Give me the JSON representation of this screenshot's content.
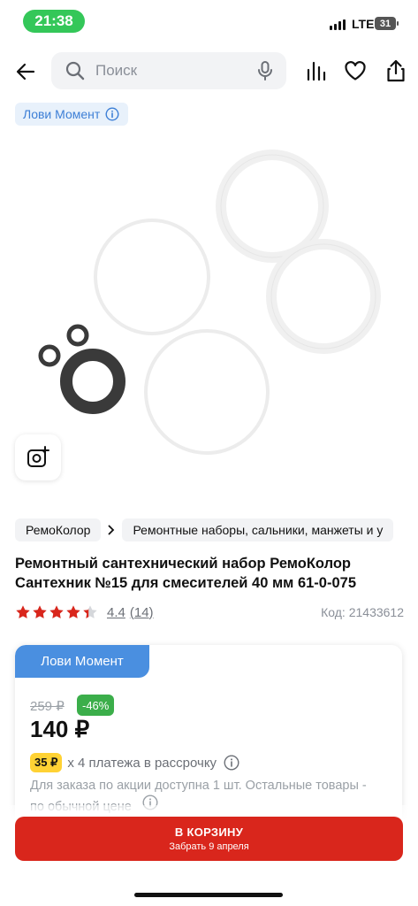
{
  "status_bar": {
    "time": "21:38",
    "network": "LTE",
    "battery": "31"
  },
  "header": {
    "search_placeholder": "Поиск",
    "icons": [
      "back-arrow-icon",
      "search-icon",
      "microphone-icon",
      "compare-icon",
      "heart-icon",
      "share-icon"
    ]
  },
  "promo_tag": {
    "label": "Лови Момент"
  },
  "breadcrumbs": [
    "РемоКолор",
    "Ремонтные наборы, сальники, манжеты и у"
  ],
  "product": {
    "title": "Ремонтный сантехнический набор РемоКолор Сантехник №15 для смесителей 40 мм 61-0-075",
    "rating": "4.4",
    "rating_value": 4.4,
    "reviews": "(14)",
    "code": "Код: 21433612"
  },
  "offer": {
    "tag": "Лови Момент",
    "old_price": "259 ₽",
    "discount": "-46%",
    "price": "140 ₽",
    "installment_amount": "35 ₽",
    "installment_text": "х 4 платежа в рассрочку",
    "note": "Для заказа по акции доступна 1 шт. Остальные товары - по обычной цене"
  },
  "cart": {
    "label": "В КОРЗИНУ",
    "sublabel": "Забрать 9 апреля"
  },
  "colors": {
    "accent": "#d9261c",
    "promo_blue": "#4a8fe0",
    "discount_green": "#3bae4a",
    "installment_yellow": "#ffd234",
    "status_green": "#34c759"
  }
}
